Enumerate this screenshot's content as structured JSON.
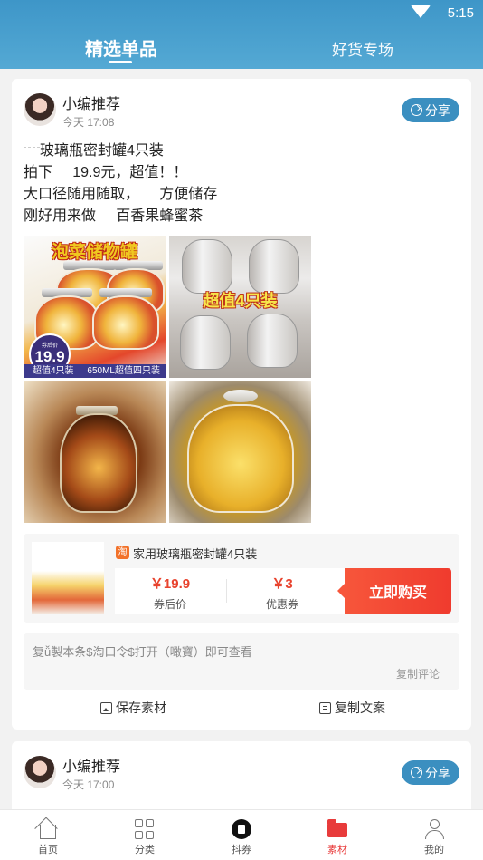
{
  "status_bar": {
    "time": "5:15"
  },
  "tabs": [
    {
      "label": "精选单品",
      "active": true
    },
    {
      "label": "好货专场",
      "active": false
    }
  ],
  "posts": [
    {
      "author": "小编推荐",
      "time": "今天 17:08",
      "share_label": "分享",
      "text_lines": [
        "玻璃瓶密封罐4只装",
        "拍下     19.9元，超值！！",
        "大口径随用随取，     方便储存",
        "刚好用来做     百香果蜂蜜茶"
      ],
      "images": [
        {
          "caption": "泡菜储物罐",
          "badge_top": "券后价",
          "badge_price": "19.9",
          "strip_left": "超值4只装",
          "strip_right": "650ML超值四只装"
        },
        {
          "caption": "超值4只装"
        },
        {
          "caption": ""
        },
        {
          "caption": ""
        }
      ],
      "product": {
        "platform_icon": "淘",
        "title": "家用玻璃瓶密封罐4只装",
        "final_price": "￥19.9",
        "final_price_label": "券后价",
        "coupon": "￥3",
        "coupon_label": "优惠券",
        "buy_label": "立即购买"
      },
      "comment": {
        "text": "复ǚ製本条$淘口令$打开（噉寶）即可查看",
        "copy_label": "复制评论"
      },
      "actions": {
        "save": "保存素材",
        "copy": "复制文案"
      }
    },
    {
      "author": "小编推荐",
      "time": "今天 17:00",
      "share_label": "分享"
    }
  ],
  "bottom_nav": [
    {
      "label": "首页",
      "icon": "home-icon"
    },
    {
      "label": "分类",
      "icon": "grid-icon"
    },
    {
      "label": "抖券",
      "icon": "coupon-icon"
    },
    {
      "label": "素材",
      "icon": "folder-icon",
      "active": true
    },
    {
      "label": "我的",
      "icon": "user-icon"
    }
  ],
  "colors": {
    "header": "#4aa0cf",
    "accent": "#e83b3b",
    "share": "#3b8fc0"
  }
}
